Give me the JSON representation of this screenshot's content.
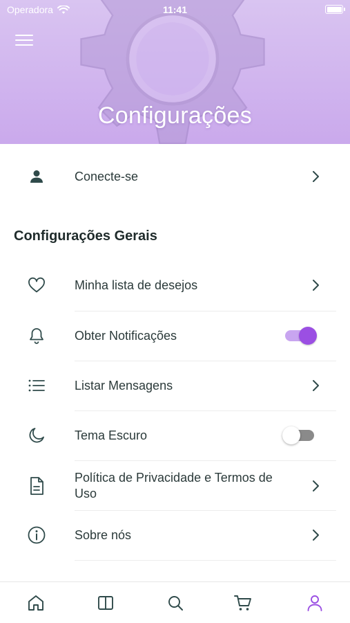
{
  "status_bar": {
    "carrier": "Operadora",
    "time": "11:41"
  },
  "header": {
    "title": "Configurações"
  },
  "login_row": {
    "label": "Conecte-se",
    "icon": "person-icon"
  },
  "general_section": {
    "title": "Configurações Gerais",
    "items": [
      {
        "label": "Minha lista de desejos",
        "icon": "heart-icon",
        "control": "chevron"
      },
      {
        "label": "Obter Notificações",
        "icon": "bell-icon",
        "control": "toggle",
        "on": true
      },
      {
        "label": "Listar Mensagens",
        "icon": "list-icon",
        "control": "chevron"
      },
      {
        "label": "Tema Escuro",
        "icon": "moon-icon",
        "control": "toggle",
        "on": false
      },
      {
        "label": "Política de Privacidade e Termos de Uso",
        "icon": "document-icon",
        "control": "chevron"
      },
      {
        "label": "Sobre nós",
        "icon": "info-icon",
        "control": "chevron"
      }
    ]
  },
  "bottom_nav": [
    {
      "icon": "home-icon",
      "active": false
    },
    {
      "icon": "book-icon",
      "active": false
    },
    {
      "icon": "search-icon",
      "active": false
    },
    {
      "icon": "cart-icon",
      "active": false
    },
    {
      "icon": "profile-icon",
      "active": true
    }
  ],
  "colors": {
    "accent": "#9b4fe3",
    "accent_light": "#c8a5f0",
    "header_bg": "#d2b8f0",
    "icon": "#2f4a4a"
  }
}
